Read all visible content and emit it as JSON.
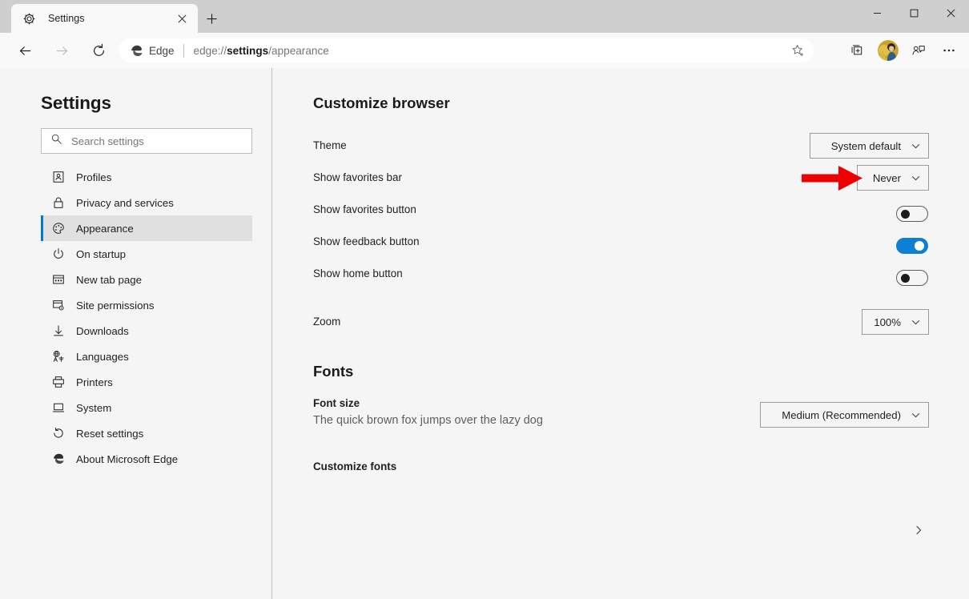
{
  "window": {
    "controls": {
      "minimize": "minimize-button",
      "maximize": "maximize-button",
      "close": "close-button"
    }
  },
  "tab": {
    "title": "Settings",
    "favicon": "gear-icon",
    "close_label": "×",
    "newtab_label": "+"
  },
  "toolbar": {
    "back": "back-arrow-icon",
    "forward": "forward-arrow-icon",
    "refresh": "refresh-icon",
    "omnibox": {
      "brand": "Edge",
      "url_prefix": "edge://",
      "url_bold": "settings",
      "url_suffix": "/appearance",
      "full_url": "edge://settings/appearance",
      "star": "favorite-star-icon"
    },
    "collections": "collections-icon",
    "profile": "profile-avatar",
    "feedback": "feedback-icon",
    "more": "more-options-icon"
  },
  "sidebar": {
    "title": "Settings",
    "search": {
      "placeholder": "Search settings",
      "value": ""
    },
    "items": [
      {
        "label": "Profiles",
        "icon": "profiles-icon",
        "selected": false
      },
      {
        "label": "Privacy and services",
        "icon": "lock-icon",
        "selected": false
      },
      {
        "label": "Appearance",
        "icon": "palette-icon",
        "selected": true
      },
      {
        "label": "On startup",
        "icon": "power-icon",
        "selected": false
      },
      {
        "label": "New tab page",
        "icon": "newtabpage-icon",
        "selected": false
      },
      {
        "label": "Site permissions",
        "icon": "permissions-icon",
        "selected": false
      },
      {
        "label": "Downloads",
        "icon": "download-icon",
        "selected": false
      },
      {
        "label": "Languages",
        "icon": "languages-icon",
        "selected": false
      },
      {
        "label": "Printers",
        "icon": "printer-icon",
        "selected": false
      },
      {
        "label": "System",
        "icon": "system-icon",
        "selected": false
      },
      {
        "label": "Reset settings",
        "icon": "reset-icon",
        "selected": false
      },
      {
        "label": "About Microsoft Edge",
        "icon": "edge-logo-icon",
        "selected": false
      }
    ]
  },
  "content": {
    "customize_heading": "Customize browser",
    "fonts_heading": "Fonts",
    "theme": {
      "label": "Theme",
      "value": "System default"
    },
    "favorites_bar": {
      "label": "Show favorites bar",
      "value": "Never"
    },
    "favorites_button": {
      "label": "Show favorites button",
      "state": "off"
    },
    "feedback_button": {
      "label": "Show feedback button",
      "state": "on"
    },
    "home_button": {
      "label": "Show home button",
      "state": "off"
    },
    "zoom": {
      "label": "Zoom",
      "value": "100%"
    },
    "font_size": {
      "label": "Font size",
      "value": "Medium (Recommended)",
      "sample": "The quick brown fox jumps over the lazy dog"
    },
    "customize_fonts": {
      "label": "Customize fonts"
    }
  },
  "annotation": {
    "arrow": "red-arrow-pointing-to-favorites-bar-dropdown",
    "color": "#ee0000"
  },
  "colors": {
    "accent": "#0078d4",
    "toggle_on": "#0f7fd4",
    "page_bg": "#f5f5f5",
    "titlebar_bg": "#cfcfcf",
    "toolbar_bg": "#f9f9f9",
    "selected_bg": "#e0e0e0"
  }
}
